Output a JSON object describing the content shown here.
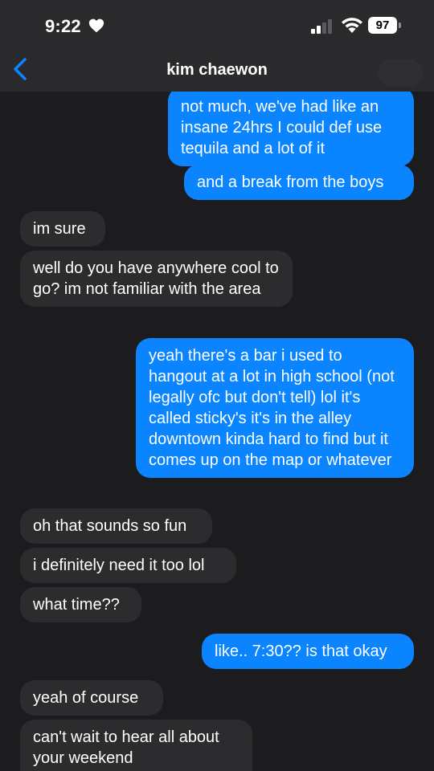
{
  "status_bar": {
    "time": "9:22",
    "battery": "97"
  },
  "nav": {
    "contact_name": "kim chaewon"
  },
  "messages": [
    {
      "from": "me",
      "text": "not much, we've had like an insane 24hrs I could def use tequila and a lot of it"
    },
    {
      "from": "me",
      "text": "and a break from the boys"
    },
    {
      "from": "them",
      "text": "im sure"
    },
    {
      "from": "them",
      "text": "well do you have anywhere cool to go? im not familiar with the area"
    },
    {
      "from": "me",
      "text": "yeah there's a bar i used to hangout at a lot in high school (not legally ofc but don't tell) lol it's called sticky's it's in the alley downtown kinda hard to find but it comes up on the map or whatever"
    },
    {
      "from": "them",
      "text": "oh that sounds so fun"
    },
    {
      "from": "them",
      "text": "i definitely need it too lol"
    },
    {
      "from": "them",
      "text": "what time??"
    },
    {
      "from": "me",
      "text": "like.. 7:30?? is that okay"
    },
    {
      "from": "them",
      "text": "yeah of course"
    },
    {
      "from": "them",
      "text": "can't wait to hear all about your weekend"
    }
  ],
  "colors": {
    "background": "#1c1c1e",
    "outgoing_bubble": "#0a84ff",
    "incoming_bubble": "#2c2c2e",
    "accent": "#0a84ff"
  },
  "icons": {
    "heart": "heart-icon",
    "signal": "cellular-signal-icon",
    "wifi": "wifi-icon",
    "battery": "battery-icon",
    "back": "chevron-left-icon"
  }
}
